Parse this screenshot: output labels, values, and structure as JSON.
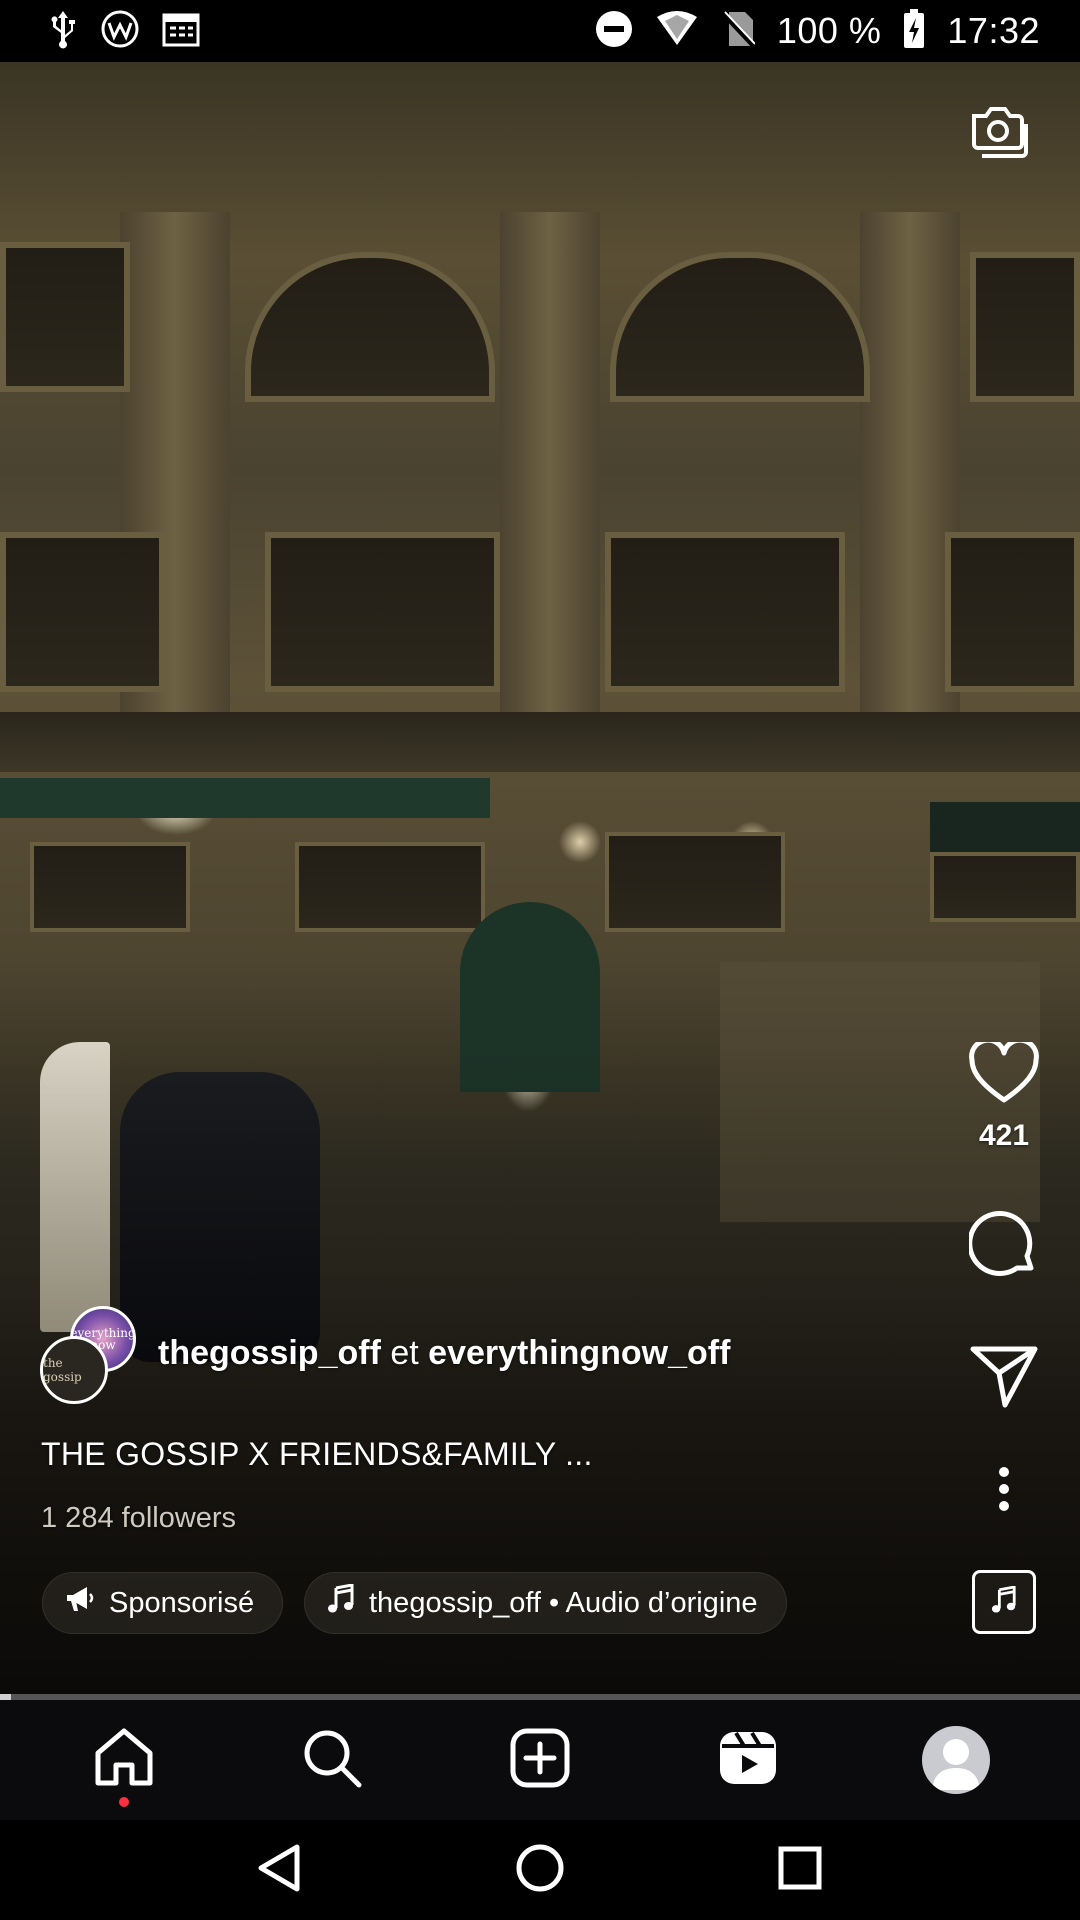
{
  "status_bar": {
    "battery_percent": "100 %",
    "time": "17:32",
    "icons": [
      "usb-icon",
      "browser-icon",
      "calendar-icon",
      "do-not-disturb-icon",
      "wifi-icon",
      "no-sim-icon",
      "battery-charging-icon"
    ]
  },
  "reel": {
    "like_count": "421",
    "authors": {
      "primary": "thegossip_off",
      "connector": "et",
      "secondary": "everythingnow_off"
    },
    "avatar_labels": {
      "back": "everything now",
      "front": "the gossip"
    },
    "caption": "THE GOSSIP X FRIENDS&FAMILY ...",
    "followers": "1 284 followers",
    "sponsored_label": "Sponsorisé",
    "audio_label": "thegossip_off • Audio d’origine",
    "progress_fraction": 0.01
  },
  "bottom_nav": {
    "items": [
      "home-icon",
      "search-icon",
      "create-icon",
      "reels-icon",
      "profile-avatar"
    ]
  },
  "system_nav": {
    "items": [
      "back-icon",
      "home-circle-icon",
      "recents-icon"
    ]
  },
  "colors": {
    "notification_dot": "#ff3040",
    "nav_background": "#0b0b0d"
  }
}
